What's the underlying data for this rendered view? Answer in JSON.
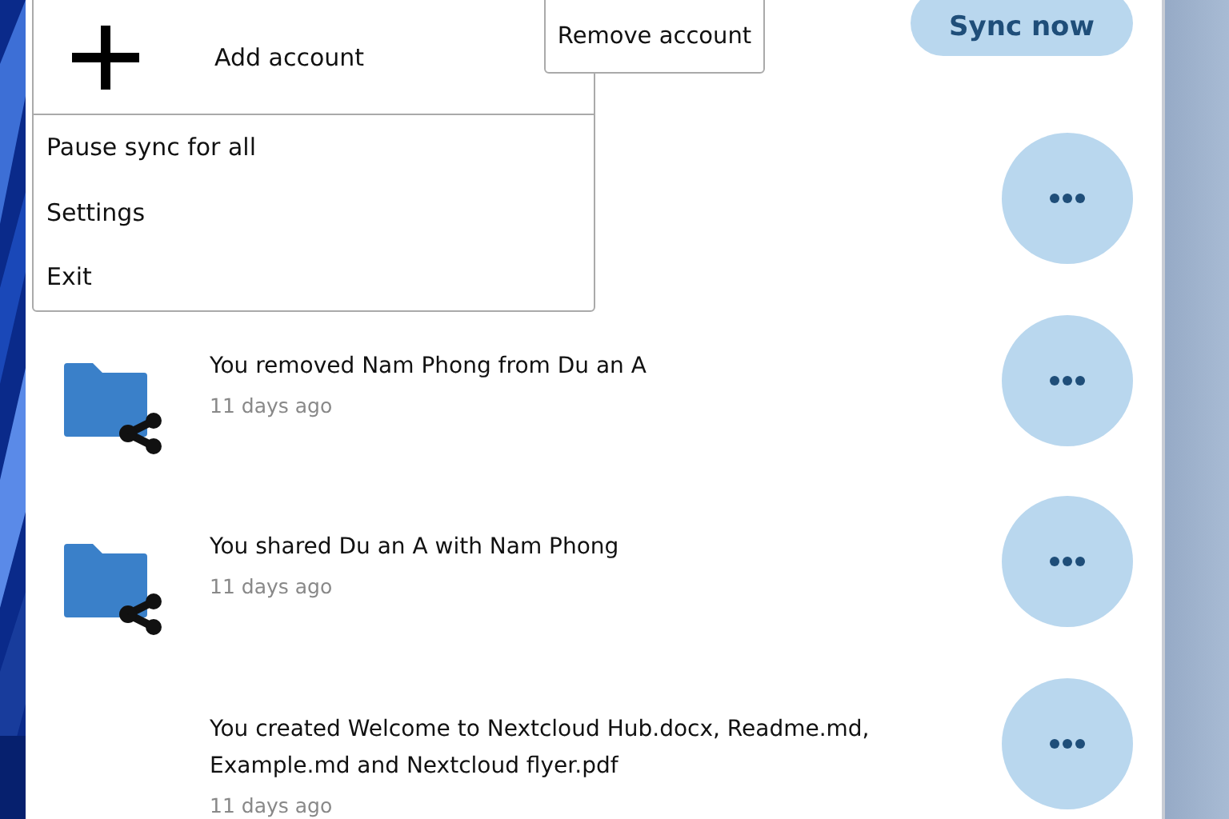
{
  "sync_button": {
    "label": "Sync now"
  },
  "activities": [
    {
      "kind": "covered"
    },
    {
      "kind": "share",
      "title": "You removed Nam Phong from Du an A",
      "time": "11 days ago"
    },
    {
      "kind": "share",
      "title": "You shared Du an A with Nam Phong",
      "time": "11 days ago"
    },
    {
      "kind": "plain",
      "title": "You created Welcome to Nextcloud Hub.docx, Readme.md, Example.md and Nextcloud flyer.pdf",
      "time": "11 days ago"
    }
  ],
  "account_menu": {
    "add_label": "Add account",
    "items": [
      "Pause sync for all",
      "Settings",
      "Exit"
    ]
  },
  "remove_account_button": {
    "label": "Remove account"
  }
}
